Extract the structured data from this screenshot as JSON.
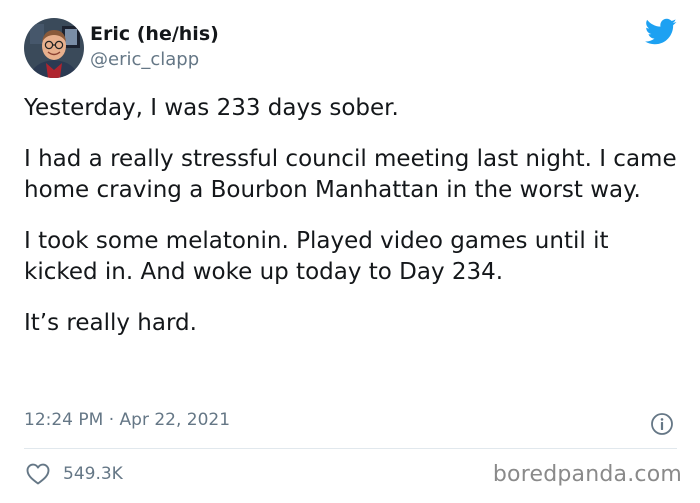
{
  "author": {
    "display_name": "Eric (he/his)",
    "handle": "@eric_clapp"
  },
  "tweet": {
    "paragraphs": [
      "Yesterday, I was 233 days sober.",
      "I had a really stressful council meeting last night. I came home craving a Bourbon Manhattan in the worst way.",
      "I took some melatonin. Played video games until it kicked in. And woke up today to Day 234.",
      "It’s really hard."
    ],
    "timestamp": "12:24 PM · Apr 22, 2021",
    "like_count": "549.3K"
  },
  "icons": {
    "brand": "twitter-bird-icon",
    "info": "info-icon",
    "like": "heart-icon"
  },
  "colors": {
    "twitter_blue": "#1da1f2",
    "secondary_text": "#657786",
    "primary_text": "#14171a"
  },
  "watermark": "boredpanda.com"
}
